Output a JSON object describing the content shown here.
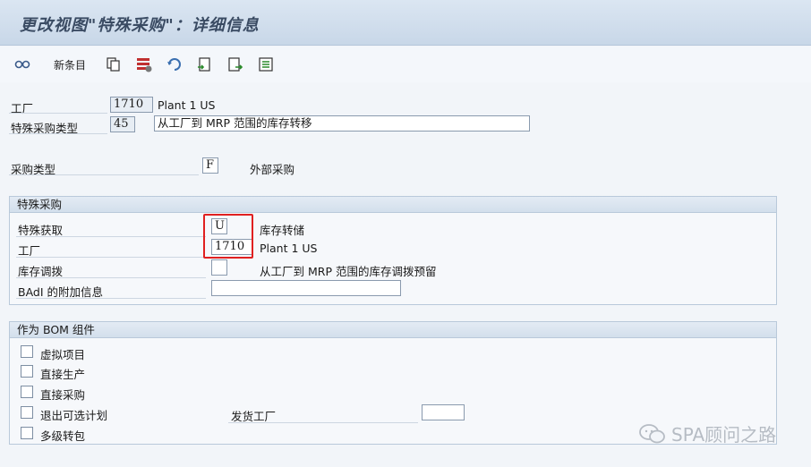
{
  "window": {
    "title": "更改视图\"特殊采购\"：详细信息"
  },
  "toolbar": {
    "new_entries_label": "新条目",
    "icons": [
      "glasses-icon",
      "copy-icon",
      "delete-icon",
      "undo-icon",
      "select-all-icon",
      "export-icon",
      "config-icon"
    ]
  },
  "header": {
    "plant_label": "工厂",
    "plant_value": "1710",
    "plant_name": "Plant 1 US",
    "special_proc_type_label": "特殊采购类型",
    "special_proc_type_value": "45",
    "special_proc_type_desc": "从工厂到 MRP 范围的库存转移",
    "proc_type_label": "采购类型",
    "proc_type_value": "F",
    "proc_type_desc": "外部采购"
  },
  "special_procurement": {
    "title": "特殊采购",
    "special_acq_label": "特殊获取",
    "special_acq_value": "U",
    "special_acq_desc": "库存转储",
    "plant_label": "工厂",
    "plant_value": "1710",
    "plant_name": "Plant 1 US",
    "stock_transfer_label": "库存调拨",
    "stock_transfer_value": "",
    "stock_transfer_desc": "从工厂到 MRP 范围的库存调拨预留",
    "badi_label": "BAdI 的附加信息",
    "badi_value": ""
  },
  "bom_component": {
    "title": "作为 BOM 组件",
    "phantom_item": "虚拟项目",
    "direct_production": "直接生产",
    "direct_procurement": "直接采购",
    "withdraw_alt_plant": "退出可选计划",
    "issuing_plant_label": "发货工厂",
    "issuing_plant_value": "",
    "multilevel_transfer": "多级转包"
  },
  "watermark": {
    "text": "SPA顾问之路"
  },
  "colors": {
    "highlight": "#e02020",
    "titlebar": "#c8d7e8"
  }
}
